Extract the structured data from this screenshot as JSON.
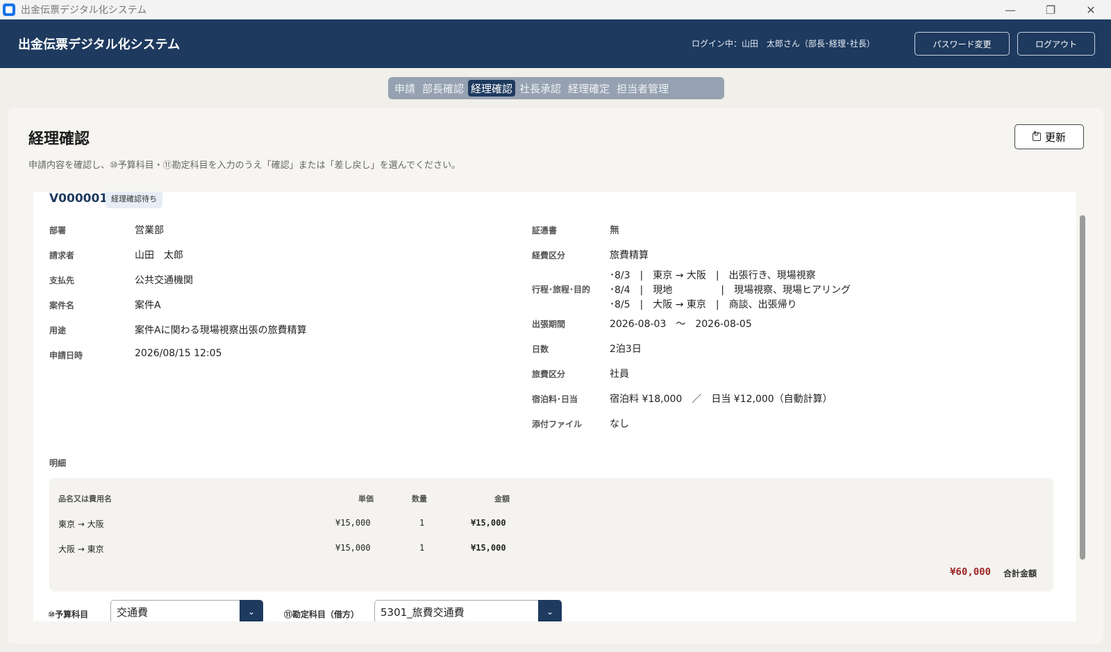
{
  "window": {
    "title": "出金伝票デジタル化システム",
    "minimize": "—",
    "restore": "❐",
    "close": "✕"
  },
  "header": {
    "title": "出金伝票デジタル化システム",
    "login_info": "ログイン中：山田　太郎さん（部長･経理･社長）",
    "password_button": "パスワード変更",
    "logout_button": "ログアウト"
  },
  "nav": {
    "tabs": [
      {
        "label": "申請"
      },
      {
        "label": "部長確認"
      },
      {
        "label": "経理確認"
      },
      {
        "label": "社長承認"
      },
      {
        "label": "経理確定"
      },
      {
        "label": "担当者管理"
      }
    ],
    "active": "経理確認"
  },
  "page": {
    "title": "経理確認",
    "refresh_button": "更新",
    "subtitle": "申請内容を確認し、⑩予算科目・⑪勘定科目を入力のうえ「確認」または「差し戻し」を選んでください。"
  },
  "voucher": {
    "id": "V000001",
    "status": "経理確認待ち",
    "left_fields": [
      {
        "label": "部署",
        "value": "営業部"
      },
      {
        "label": "請求者",
        "value": "山田　太郎"
      },
      {
        "label": "支払先",
        "value": "公共交通機関"
      },
      {
        "label": "案件名",
        "value": "案件A"
      },
      {
        "label": "用途",
        "value": "案件Aに関わる現場視察出張の旅費精算"
      },
      {
        "label": "申請日時",
        "value": "2026/08/15 12:05"
      }
    ],
    "right_fields": {
      "certificate": {
        "label": "証憑書",
        "value": "無"
      },
      "expense_type": {
        "label": "経費区分",
        "value": "旅費精算"
      },
      "itinerary_label": "行程･旅程･目的",
      "itinerary": [
        "･8/3　|　東京 → 大阪　|　出張行き、現場視察",
        "･8/4　|　現地　　　　　|　現場視察、現場ヒアリング",
        "･8/5　|　大阪 → 東京　|　商談、出張帰り"
      ],
      "period": {
        "label": "出張期間",
        "value": "2026-08-03　～　2026-08-05"
      },
      "days": {
        "label": "日数",
        "value": "2泊3日"
      },
      "travel_class": {
        "label": "旅費区分",
        "value": "社員"
      },
      "lodging": {
        "label": "宿泊料･日当",
        "value": "宿泊料 ¥18,000　／　日当 ¥12,000（自動計算）"
      },
      "attachment": {
        "label": "添付ファイル",
        "value": "なし"
      }
    },
    "details": {
      "section_label": "明細",
      "headers": {
        "name": "品名又は費用名",
        "unit_price": "単価",
        "quantity": "数量",
        "amount": "金額"
      },
      "rows": [
        {
          "name": "東京 → 大阪",
          "unit_price": "¥15,000",
          "quantity": "1",
          "amount": "¥15,000"
        },
        {
          "name": "大阪 → 東京",
          "unit_price": "¥15,000",
          "quantity": "1",
          "amount": "¥15,000"
        }
      ],
      "total_amount": "¥60,000",
      "total_label": "合計金額"
    },
    "form": {
      "budget_label": "⑩予算科目",
      "budget_value": "交通費",
      "account_label": "⑪勘定科目（借方）",
      "account_value": "5301_旅費交通費"
    }
  },
  "colors": {
    "header_bg": "#1e3a5f",
    "nav_bg": "#96a2b1",
    "total_color": "#a02828"
  }
}
